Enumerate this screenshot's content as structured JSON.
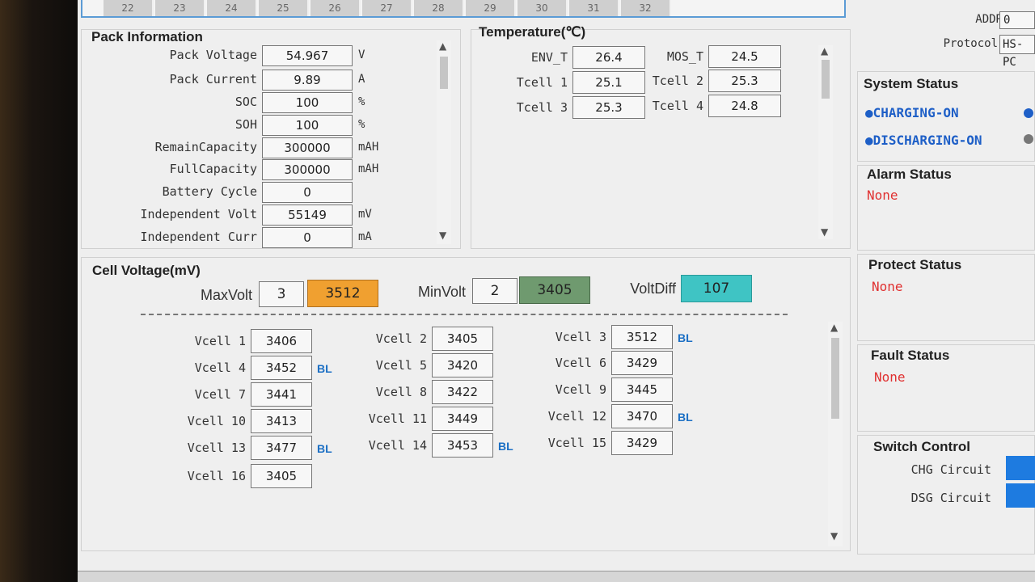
{
  "top_cell_tabs": [
    "22",
    "23",
    "24",
    "25",
    "26",
    "27",
    "28",
    "29",
    "30",
    "31",
    "32"
  ],
  "top_right": {
    "addr_label": "ADDR",
    "addr_value": "0",
    "protocol_label": "Protocol",
    "protocol_value": "HS-PC"
  },
  "pack": {
    "title": "Pack Information",
    "rows": [
      {
        "label": "Pack Voltage",
        "value": "54.967",
        "unit": "V"
      },
      {
        "label": "Pack Current",
        "value": "9.89",
        "unit": "A"
      },
      {
        "label": "SOC",
        "value": "100",
        "unit": "%"
      },
      {
        "label": "SOH",
        "value": "100",
        "unit": "%"
      },
      {
        "label": "RemainCapacity",
        "value": "300000",
        "unit": "mAH"
      },
      {
        "label": "FullCapacity",
        "value": "300000",
        "unit": "mAH"
      },
      {
        "label": "Battery Cycle",
        "value": "0",
        "unit": ""
      },
      {
        "label": "Independent Volt",
        "value": "55149",
        "unit": "mV"
      },
      {
        "label": "Independent Curr",
        "value": "0",
        "unit": "mA"
      }
    ]
  },
  "temperature": {
    "title": "Temperature(℃)",
    "items": [
      {
        "label": "ENV_T",
        "value": "26.4"
      },
      {
        "label": "MOS_T",
        "value": "24.5"
      },
      {
        "label": "Tcell 1",
        "value": "25.1"
      },
      {
        "label": "Tcell 2",
        "value": "25.3"
      },
      {
        "label": "Tcell 3",
        "value": "25.3"
      },
      {
        "label": "Tcell 4",
        "value": "24.8"
      }
    ]
  },
  "cell_voltage": {
    "title": "Cell Voltage(mV)",
    "max_label": "MaxVolt",
    "max_index": "3",
    "max_value": "3512",
    "min_label": "MinVolt",
    "min_index": "2",
    "min_value": "3405",
    "diff_label": "VoltDiff",
    "diff_value": "107",
    "cells": [
      {
        "label": "Vcell 1",
        "value": "3406",
        "flag": ""
      },
      {
        "label": "Vcell 2",
        "value": "3405",
        "flag": ""
      },
      {
        "label": "Vcell 3",
        "value": "3512",
        "flag": "BL"
      },
      {
        "label": "Vcell 4",
        "value": "3452",
        "flag": "BL"
      },
      {
        "label": "Vcell 5",
        "value": "3420",
        "flag": ""
      },
      {
        "label": "Vcell 6",
        "value": "3429",
        "flag": ""
      },
      {
        "label": "Vcell 7",
        "value": "3441",
        "flag": ""
      },
      {
        "label": "Vcell 8",
        "value": "3422",
        "flag": ""
      },
      {
        "label": "Vcell 9",
        "value": "3445",
        "flag": ""
      },
      {
        "label": "Vcell 10",
        "value": "3413",
        "flag": ""
      },
      {
        "label": "Vcell 11",
        "value": "3449",
        "flag": ""
      },
      {
        "label": "Vcell 12",
        "value": "3470",
        "flag": "BL"
      },
      {
        "label": "Vcell 13",
        "value": "3477",
        "flag": "BL"
      },
      {
        "label": "Vcell 14",
        "value": "3453",
        "flag": "BL"
      },
      {
        "label": "Vcell 15",
        "value": "3429",
        "flag": ""
      },
      {
        "label": "Vcell 16",
        "value": "3405",
        "flag": ""
      }
    ]
  },
  "system_status": {
    "title": "System Status",
    "charging": "●CHARGING-ON",
    "discharging": "●DISCHARGING-ON"
  },
  "alarm_status": {
    "title": "Alarm Status",
    "value": "None"
  },
  "protect_status": {
    "title": "Protect Status",
    "value": "None"
  },
  "fault_status": {
    "title": "Fault Status",
    "value": "None"
  },
  "switch_control": {
    "title": "Switch Control",
    "chg_label": "CHG Circuit",
    "dsg_label": "DSG Circuit"
  },
  "colors": {
    "max_volt_bg": "#f0a030",
    "min_volt_bg": "#6f9a6f",
    "volt_diff_bg": "#3fc4c4",
    "status_blue": "#1e5fc7",
    "none_red": "#e03030",
    "bl_blue": "#1b6fc4"
  }
}
